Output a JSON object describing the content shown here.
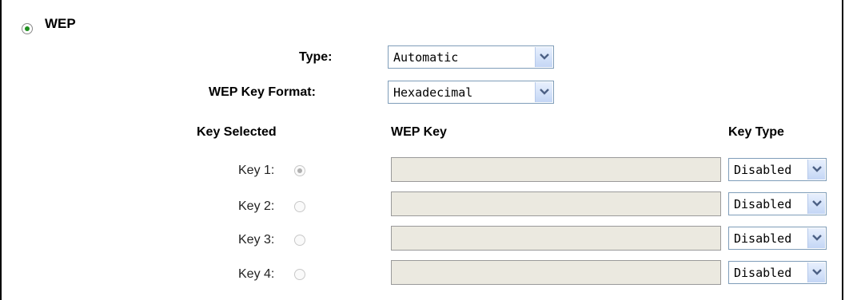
{
  "section": {
    "mode_label": "WEP",
    "selected": true
  },
  "type": {
    "label": "Type:",
    "value": "Automatic"
  },
  "key_format": {
    "label": "WEP Key Format:",
    "value": "Hexadecimal"
  },
  "table": {
    "headers": {
      "key_selected": "Key Selected",
      "wep_key": "WEP Key",
      "key_type": "Key Type"
    },
    "keys": [
      {
        "label": "Key 1:",
        "selected": true,
        "value": "",
        "type": "Disabled"
      },
      {
        "label": "Key 2:",
        "selected": false,
        "value": "",
        "type": "Disabled"
      },
      {
        "label": "Key 3:",
        "selected": false,
        "value": "",
        "type": "Disabled"
      },
      {
        "label": "Key 4:",
        "selected": false,
        "value": "",
        "type": "Disabled"
      }
    ]
  },
  "colors": {
    "radio_checked": "#1f8f1f",
    "disabled_field": "#ebe9e0",
    "select_border": "#7f9db9"
  }
}
